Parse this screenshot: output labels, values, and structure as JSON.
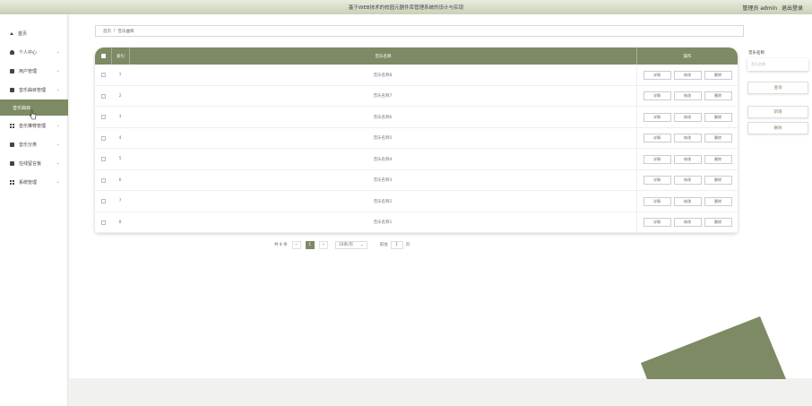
{
  "header": {
    "title": "基于WEB技术的校园元器件库管理系统的设计与实现",
    "role": "管理员 admin",
    "logout": "退出登录"
  },
  "sidebar": {
    "items": [
      {
        "label": "首页",
        "icon": "home-icon"
      },
      {
        "label": "个人中心",
        "icon": "user-icon",
        "arrow": "⌄"
      },
      {
        "label": "用户管理",
        "icon": "users-icon",
        "arrow": "⌄"
      },
      {
        "label": "音乐曲目管理",
        "icon": "music-icon",
        "arrow": "⌄"
      },
      {
        "label": "音乐曲目",
        "active": true
      },
      {
        "label": "音乐推荐管理",
        "icon": "grid-icon",
        "arrow": "⌄"
      },
      {
        "label": "音乐分类",
        "icon": "category-icon",
        "arrow": "⌄"
      },
      {
        "label": "在线留言板",
        "icon": "message-icon",
        "arrow": "⌄"
      },
      {
        "label": "系统管理",
        "icon": "settings-icon",
        "arrow": "⌄"
      }
    ]
  },
  "breadcrumb": {
    "home": "首页",
    "sep": "/",
    "current": "音乐曲目"
  },
  "table": {
    "headers": {
      "index": "索引",
      "name": "音乐名称",
      "ops": "操作"
    },
    "buttons": {
      "detail": "详情",
      "edit": "修改",
      "delete": "删除"
    },
    "rows": [
      {
        "index": "1",
        "name": "音乐名称8"
      },
      {
        "index": "2",
        "name": "音乐名称7"
      },
      {
        "index": "3",
        "name": "音乐名称6"
      },
      {
        "index": "4",
        "name": "音乐名称5"
      },
      {
        "index": "5",
        "name": "音乐名称4"
      },
      {
        "index": "6",
        "name": "音乐名称3"
      },
      {
        "index": "7",
        "name": "音乐名称2"
      },
      {
        "index": "8",
        "name": "音乐名称1"
      }
    ]
  },
  "pager": {
    "total": "共 8 条",
    "prev": "<",
    "current_page": "1",
    "next": ">",
    "page_size": "10条/页",
    "goto_label": "前往",
    "goto_value": "1",
    "goto_unit": "页"
  },
  "search": {
    "label": "音乐名称",
    "placeholder": "音乐名称",
    "search_button": "查询",
    "add_button": "新增",
    "delete_button": "删除"
  },
  "colors": {
    "accent": "#7e8a63"
  }
}
